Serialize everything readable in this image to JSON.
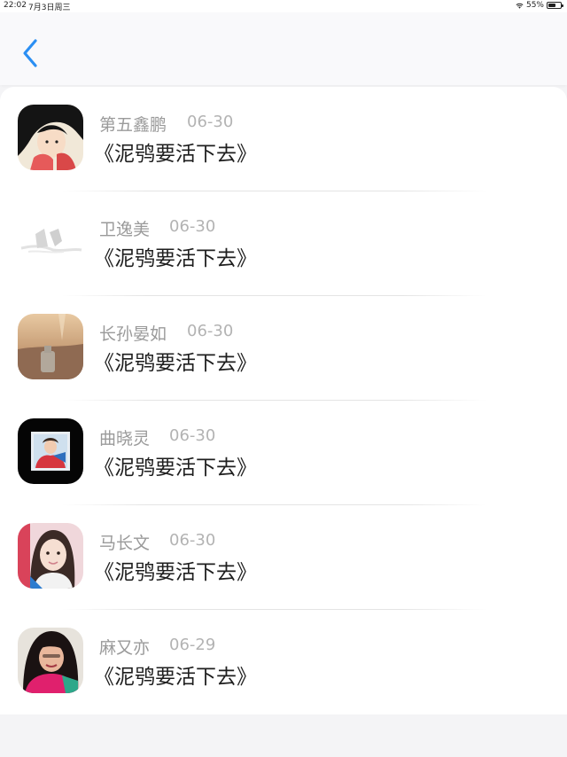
{
  "status_bar": {
    "time": "22:02",
    "date": "7月3日周三",
    "battery": "55%",
    "battery_level": 0.55
  },
  "nav": {
    "back_icon": "chevron-left-icon",
    "accent_color": "#2b8ff3"
  },
  "items": [
    {
      "name": "第五鑫鹏",
      "date": "06-30",
      "title": "《泥鸮要活下去》",
      "avatar": "anime-girl-avatar"
    },
    {
      "name": "卫逸美",
      "date": "06-30",
      "title": "《泥鸮要活下去》",
      "avatar": "sketch-avatar"
    },
    {
      "name": "长孙晏如",
      "date": "06-30",
      "title": "《泥鸮要活下去》",
      "avatar": "beach-bottle-avatar"
    },
    {
      "name": "曲晓灵",
      "date": "06-30",
      "title": "《泥鸮要活下去》",
      "avatar": "framed-photo-avatar"
    },
    {
      "name": "马长文",
      "date": "06-30",
      "title": "《泥鸮要活下去》",
      "avatar": "selfie-avatar"
    },
    {
      "name": "麻又亦",
      "date": "06-29",
      "title": "《泥鸮要活下去》",
      "avatar": "portrait-avatar"
    }
  ]
}
